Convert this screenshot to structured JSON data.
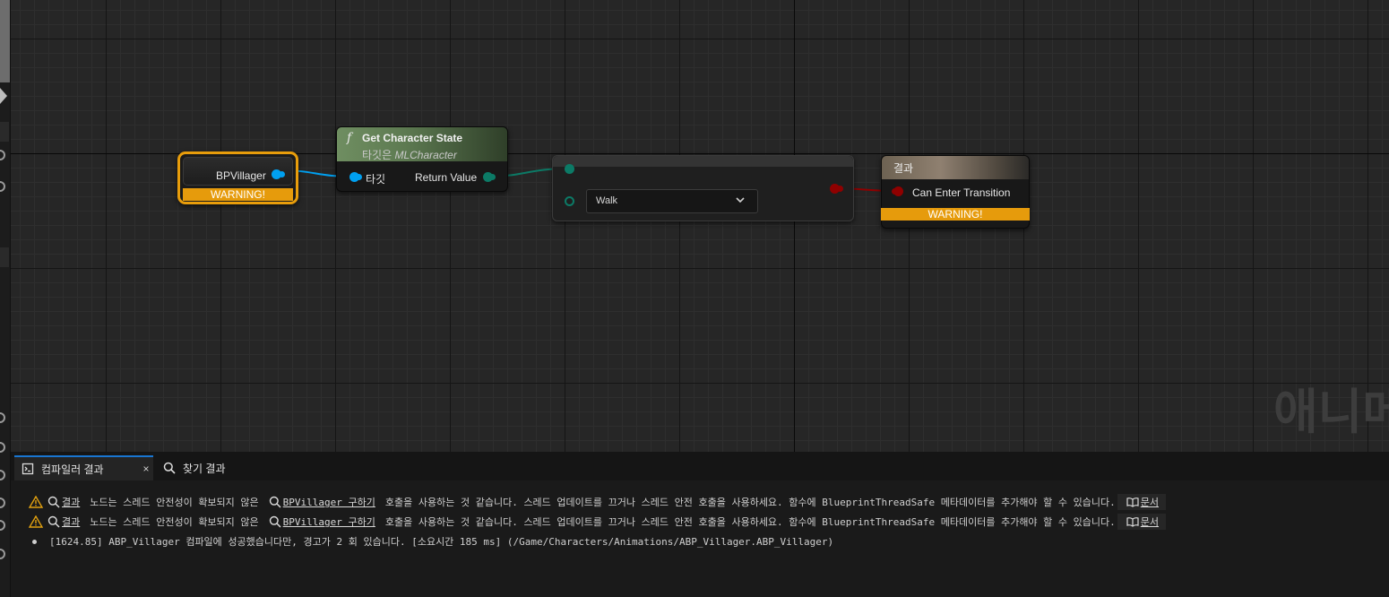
{
  "graph": {
    "watermark": "애니메",
    "nodes": {
      "variable": {
        "label": "BPVillager",
        "warning": "WARNING!"
      },
      "function": {
        "glyph": "f",
        "title": "Get Character State",
        "subtitle_prefix": "타깃은",
        "subtitle_class": "MLCharacter",
        "input_pin": "타깃",
        "output_pin": "Return Value"
      },
      "select": {
        "dropdown_value": "Walk"
      },
      "result": {
        "title": "결과",
        "input_pin": "Can Enter Transition",
        "warning": "WARNING!"
      }
    },
    "colors": {
      "object_pin": "#00a0f0",
      "enum_pin": "#0c7a66",
      "bool_pin": "#8f0000",
      "warning": "#e69b0c",
      "function_header": "#6f8e61"
    }
  },
  "panel": {
    "tabs": [
      {
        "label": "컴파일러 결과",
        "icon": "compiler-results-icon",
        "closable": true,
        "close": "×"
      },
      {
        "label": "찾기 결과",
        "icon": "search-icon"
      }
    ],
    "messages": [
      {
        "type": "warning",
        "result_link": "결과",
        "text1": "노드는 스레드 안전성이 확보되지 않은",
        "node_link": "BPVillager 구하기",
        "text2": "호출을 사용하는 것 같습니다. 스레드 업데이트를 끄거나 스레드 안전 호출을 사용하세요. 함수에 BlueprintThreadSafe 메타데이터를 추가해야 할 수 있습니다.",
        "doc_link": "문서"
      },
      {
        "type": "warning",
        "result_link": "결과",
        "text1": "노드는 스레드 안전성이 확보되지 않은",
        "node_link": "BPVillager 구하기",
        "text2": "호출을 사용하는 것 같습니다. 스레드 업데이트를 끄거나 스레드 안전 호출을 사용하세요. 함수에 BlueprintThreadSafe 메타데이터를 추가해야 할 수 있습니다.",
        "doc_link": "문서"
      },
      {
        "type": "info",
        "text": "[1624.85] ABP_Villager 컴파일에 성공했습니다만, 경고가 2 회 있습니다. [소요시간 185 ms] (/Game/Characters/Animations/ABP_Villager.ABP_Villager)"
      }
    ]
  }
}
